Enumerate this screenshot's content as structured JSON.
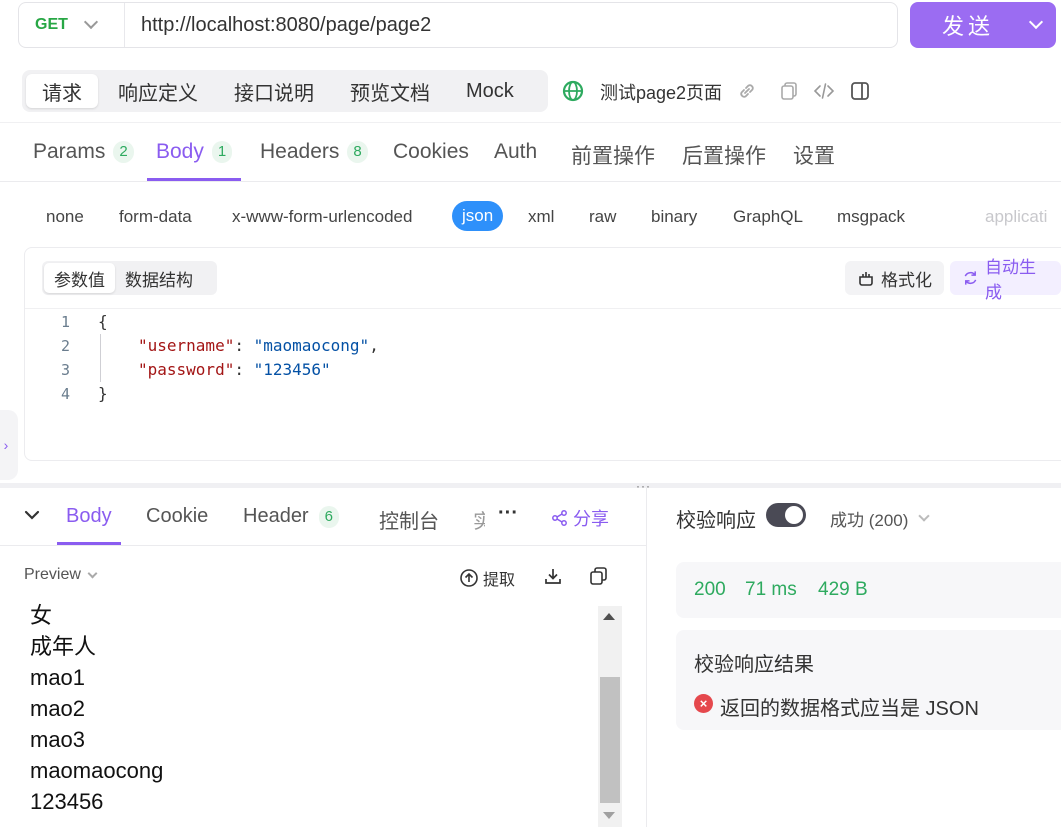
{
  "request": {
    "method": "GET",
    "url": "http://localhost:8080/page/page2",
    "send_label": "发送"
  },
  "modes": [
    "请求",
    "响应定义",
    "接口说明",
    "预览文档",
    "Mock"
  ],
  "page_name": "测试page2页面",
  "request_tabs": [
    {
      "label": "Params",
      "count": "2"
    },
    {
      "label": "Body",
      "count": "1"
    },
    {
      "label": "Headers",
      "count": "8"
    },
    {
      "label": "Cookies"
    },
    {
      "label": "Auth"
    },
    {
      "label": "前置操作"
    },
    {
      "label": "后置操作"
    },
    {
      "label": "设置"
    }
  ],
  "body_types": [
    "none",
    "form-data",
    "x-www-form-urlencoded",
    "json",
    "xml",
    "raw",
    "binary",
    "GraphQL",
    "msgpack",
    "applicati"
  ],
  "editor": {
    "segments": [
      "参数值",
      "数据结构"
    ],
    "format_label": "格式化",
    "autogen_label": "自动生成",
    "line_numbers": [
      "1",
      "2",
      "3",
      "4"
    ],
    "lines": {
      "open": "{",
      "key1": "\"username\"",
      "val1": "\"maomaocong\"",
      "key2": "\"password\"",
      "val2": "\"123456\"",
      "close": "}"
    }
  },
  "response": {
    "tabs": [
      {
        "label": "Body"
      },
      {
        "label": "Cookie"
      },
      {
        "label": "Header",
        "count": "6"
      },
      {
        "label": "控制台"
      },
      {
        "label": "实"
      }
    ],
    "more": "···",
    "share_label": "分享",
    "preview_label": "Preview",
    "extract_label": "提取",
    "output_lines": [
      "女",
      "成年人",
      "mao1",
      "mao2",
      "mao3",
      "maomaocong",
      "123456"
    ]
  },
  "validation": {
    "label": "校验响应",
    "enabled": true,
    "status": "成功 (200)",
    "code": "200",
    "time": "71 ms",
    "size": "429 B",
    "result_title": "校验响应结果",
    "error_message": "返回的数据格式应当是 JSON"
  },
  "colors": {
    "accent": "#8a5cf0",
    "send_bg": "#9b6cf2",
    "method": "#28a745",
    "success": "#2eaa5f",
    "json_chip": "#2e90fa",
    "error": "#e5484d"
  }
}
